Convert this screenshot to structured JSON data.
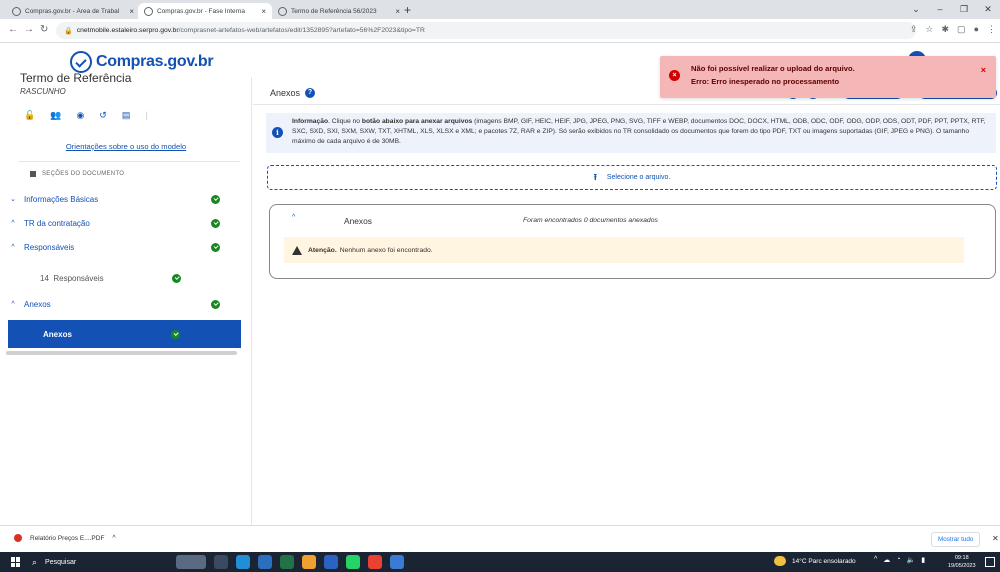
{
  "browser": {
    "tabs": [
      {
        "title": "Compras.gov.br - Área de Trabal"
      },
      {
        "title": "Compras.gov.br - Fase Interna"
      },
      {
        "title": "Termo de Referência 56/2023"
      }
    ],
    "url_host": "cnetmobile.estaleiro.serpro.gov.br",
    "url_path": "/comprasnet-artefatos-web/artefatos/edit/1352895?artefato=56%2F2023&tipo=TR"
  },
  "site": {
    "logo_text": "Compras.gov.br",
    "brand_color": "#1351b4"
  },
  "sidebar": {
    "doc_title": "Termo de Referência",
    "doc_status": "RASCUNHO",
    "guide_link": "Orientações sobre o uso do modelo",
    "sections_header": "SEÇÕES DO DOCUMENTO",
    "items": [
      {
        "label": "Informações Básicas"
      },
      {
        "label": "TR da contratação"
      },
      {
        "label": "Responsáveis"
      },
      {
        "label": "14  Responsáveis"
      },
      {
        "label": "Anexos"
      },
      {
        "label": "Anexos"
      }
    ]
  },
  "main": {
    "title": "Anexos",
    "help": "?",
    "info": {
      "label": "Informação",
      "text1": ". Clique no ",
      "bold": "botão abaixo para anexar arquivos",
      "text2": " (imagens BMP, GIF, HEIC, HEIF, JPG, JPEG, PNG, SVG, TIFF e WEBP, documentos DOC, DOCX, HTML, ODB, ODC, ODF, ODG, ODP, ODS, ODT, PDF, PPT, PPTX, RTF, SXC, SXD, SXI, SXM, SXW, TXT, XHTML, XLS, XLSX e XML; e pacotes 7Z, RAR e ZIP). Só serão exibidos no TR consolidado os documentos que forem do tipo PDF, TXT ou imagens suportadas (GIF, JPEG e PNG). O tamanho máximo de cada arquivo é de 30MB."
    },
    "upload_label": "Selecione o arquivo.",
    "attachments": {
      "title": "Anexos",
      "count_text": "Foram encontrados 0 documentos anexados",
      "warning_label": "Atenção.",
      "warning_text": "Nenhum anexo foi encontrado."
    }
  },
  "toast": {
    "line1": "Não foi possível realizar o upload do arquivo.",
    "line2": "Erro: Erro inesperado no processamento",
    "close": "×",
    "color": "#f4b6b6"
  },
  "download_bar": {
    "file": "Relatório Preços E....PDF",
    "show_all": "Mostrar tudo"
  },
  "taskbar": {
    "search": "Pesquisar",
    "weather": "14°C  Parc ensolarado",
    "time": "09:18",
    "date": "19/05/2023"
  }
}
